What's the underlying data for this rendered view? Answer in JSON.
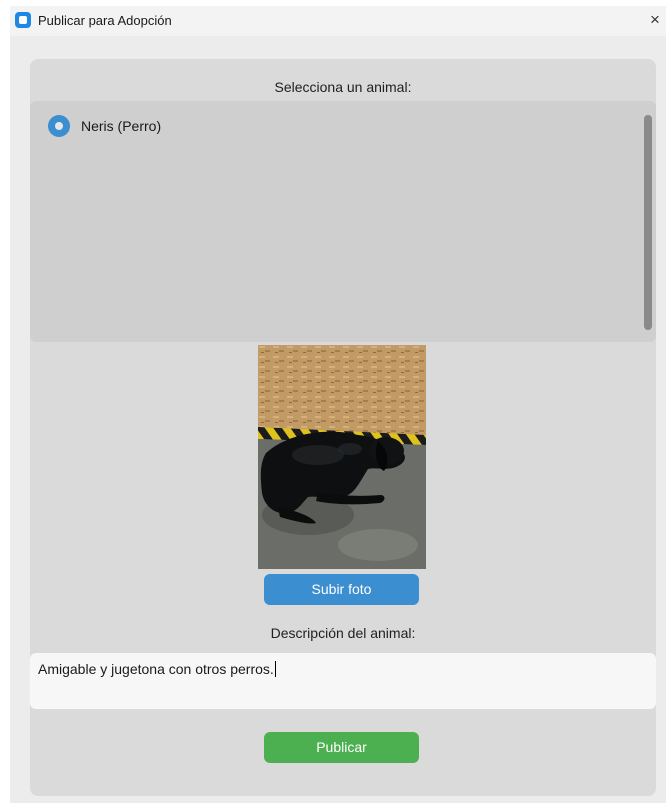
{
  "window": {
    "title": "Publicar para Adopción",
    "close_symbol": "×",
    "icon": "app-icon"
  },
  "form": {
    "select_label": "Selecciona un animal:",
    "animals": [
      {
        "label": "Neris (Perro)",
        "selected": true
      }
    ],
    "photo_icon": "dog-photo",
    "upload_button": "Subir foto",
    "description_label": "Descripción del animal:",
    "description_value": "Amigable y jugetona con otros perros.",
    "publish_button": "Publicar"
  },
  "colors": {
    "accent_blue": "#3b8ed0",
    "publish_green": "#4caf50",
    "panel": "#dadada",
    "list_bg": "#cfcfcf"
  }
}
